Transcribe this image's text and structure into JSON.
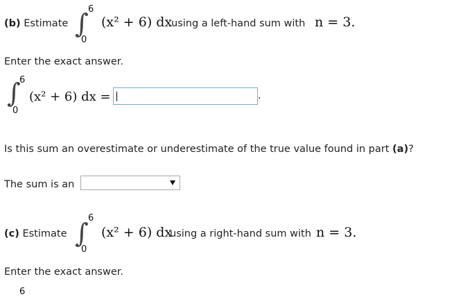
{
  "part_b": {
    "label": "(b)",
    "prefix": "Estimate",
    "upper": "6",
    "lower": "0",
    "integrand": "(x² + 6) dx",
    "suffix_text": "using a left-hand sum with",
    "n_expr": "n = 3.",
    "instruction": "Enter the exact answer.",
    "answer_upper": "6",
    "answer_lower": "0",
    "answer_integrand": "(x² + 6) dx =",
    "answer_value": "",
    "trailing_dot": ".",
    "question_pre": "Is this sum an overestimate or underestimate of the true value found in part",
    "question_part": "(a)",
    "question_end": "?",
    "sum_label": "The sum is an",
    "dropdown_value": ""
  },
  "part_c": {
    "label": "(c)",
    "prefix": "Estimate",
    "upper": "6",
    "lower": "0",
    "integrand": "(x² + 6) dx",
    "suffix_text": "using a right-hand sum with",
    "n_expr": "n = 3.",
    "instruction": "Enter the exact answer.",
    "answer_upper": "6"
  },
  "colors": {
    "text": "#222222",
    "input_border": "#7aa7d6",
    "select_border": "#a9a9a9"
  }
}
